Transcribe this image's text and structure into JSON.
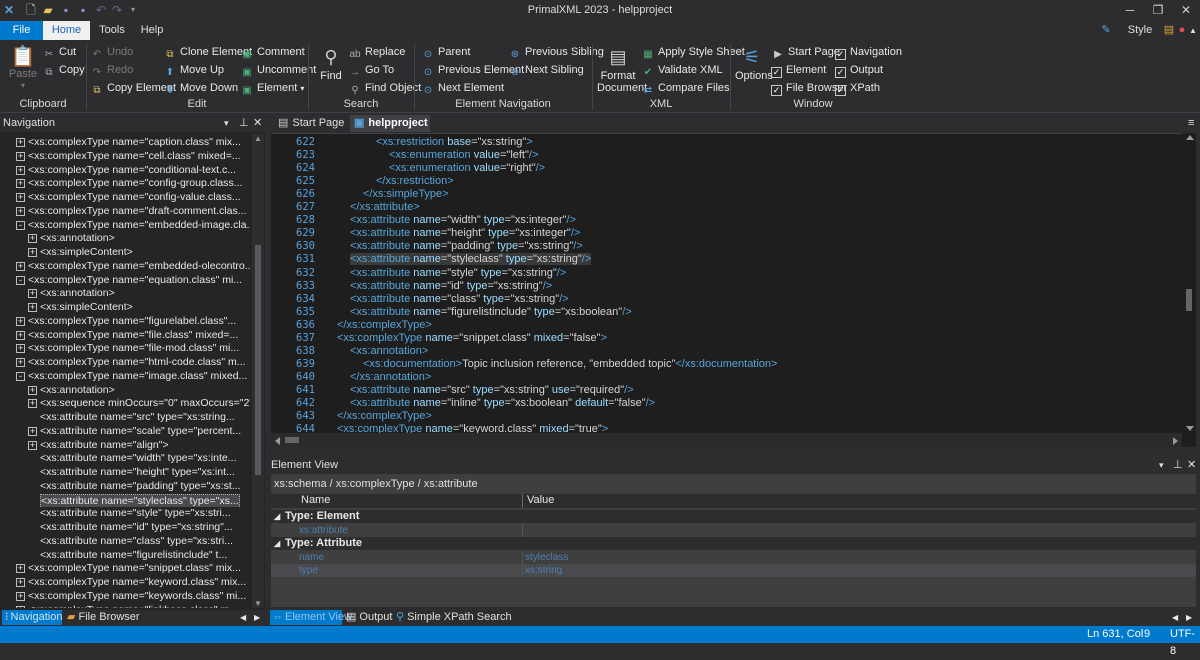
{
  "window": {
    "title": "PrimalXML 2023 - helpproject"
  },
  "ribbon_tabs": [
    "File",
    "Home",
    "Tools",
    "Help"
  ],
  "style_menu": "Style",
  "clipboard": {
    "paste": "Paste",
    "cut": "Cut",
    "copy": "Copy",
    "group": "Clipboard"
  },
  "edit": {
    "undo": "Undo",
    "redo": "Redo",
    "copy_element": "Copy Element",
    "clone_element": "Clone Element",
    "move_up": "Move Up",
    "move_down": "Move Down",
    "comment": "Comment",
    "uncomment": "Uncomment",
    "element": "Element",
    "group": "Edit"
  },
  "search": {
    "find": "Find",
    "replace": "Replace",
    "goto": "Go To",
    "find_object": "Find Object",
    "group": "Search"
  },
  "element_nav": {
    "parent": "Parent",
    "previous_element": "Previous Element",
    "next_element": "Next Element",
    "previous_sibling": "Previous Sibling",
    "next_sibling": "Next Sibling",
    "group": "Element Navigation"
  },
  "xml": {
    "format_document_1": "Format",
    "format_document_2": "Document",
    "apply_style_sheet": "Apply Style Sheet",
    "validate_xml": "Validate XML",
    "compare_files": "Compare Files",
    "group": "XML"
  },
  "window_group": {
    "options": "Options",
    "start_page": "Start Page",
    "element": "Element",
    "file_browser": "File Browser",
    "navigation": "Navigation",
    "output": "Output",
    "xpath": "XPath",
    "group": "Window"
  },
  "navigation": {
    "title": "Navigation",
    "rows": [
      {
        "depth": 1,
        "exp": "+",
        "text": "<xs:complexType name=\"caption.class\" mix..."
      },
      {
        "depth": 1,
        "exp": "+",
        "text": "<xs:complexType name=\"cell.class\" mixed=..."
      },
      {
        "depth": 1,
        "exp": "+",
        "text": "<xs:complexType name=\"conditional-text.c..."
      },
      {
        "depth": 1,
        "exp": "+",
        "text": "<xs:complexType name=\"config-group.class..."
      },
      {
        "depth": 1,
        "exp": "+",
        "text": "<xs:complexType name=\"config-value.class..."
      },
      {
        "depth": 1,
        "exp": "+",
        "text": "<xs:complexType name=\"draft-comment.clas..."
      },
      {
        "depth": 1,
        "exp": "-",
        "text": "<xs:complexType name=\"embedded-image.cla..."
      },
      {
        "depth": 2,
        "exp": "+",
        "text": "<xs:annotation>"
      },
      {
        "depth": 2,
        "exp": "+",
        "text": "<xs:simpleContent>"
      },
      {
        "depth": 1,
        "exp": "+",
        "text": "<xs:complexType name=\"embedded-olecontro..."
      },
      {
        "depth": 1,
        "exp": "-",
        "text": "<xs:complexType name=\"equation.class\" mi..."
      },
      {
        "depth": 2,
        "exp": "+",
        "text": "<xs:annotation>"
      },
      {
        "depth": 2,
        "exp": "+",
        "text": "<xs:simpleContent>"
      },
      {
        "depth": 1,
        "exp": "+",
        "text": "<xs:complexType name=\"figurelabel.class\"..."
      },
      {
        "depth": 1,
        "exp": "+",
        "text": "<xs:complexType name=\"file.class\" mixed=..."
      },
      {
        "depth": 1,
        "exp": "+",
        "text": "<xs:complexType name=\"file-mod.class\" mi..."
      },
      {
        "depth": 1,
        "exp": "+",
        "text": "<xs:complexType name=\"html-code.class\" m..."
      },
      {
        "depth": 1,
        "exp": "-",
        "text": "<xs:complexType name=\"image.class\" mixed..."
      },
      {
        "depth": 2,
        "exp": "+",
        "text": "<xs:annotation>"
      },
      {
        "depth": 2,
        "exp": "+",
        "text": "<xs:sequence minOccurs=\"0\" maxOccurs=\"2\"..."
      },
      {
        "depth": 2,
        "exp": "",
        "text": "<xs:attribute name=\"src\" type=\"xs:string..."
      },
      {
        "depth": 2,
        "exp": "+",
        "text": "<xs:attribute name=\"scale\" type=\"percent..."
      },
      {
        "depth": 2,
        "exp": "+",
        "text": "<xs:attribute name=\"align\">"
      },
      {
        "depth": 2,
        "exp": "",
        "text": "<xs:attribute name=\"width\" type=\"xs:inte..."
      },
      {
        "depth": 2,
        "exp": "",
        "text": "<xs:attribute name=\"height\" type=\"xs:int..."
      },
      {
        "depth": 2,
        "exp": "",
        "text": "<xs:attribute name=\"padding\" type=\"xs:st..."
      },
      {
        "depth": 2,
        "exp": "",
        "text": "<xs:attribute name=\"styleclass\" type=\"xs...",
        "selected": true
      },
      {
        "depth": 2,
        "exp": "",
        "text": "<xs:attribute name=\"style\" type=\"xs:stri..."
      },
      {
        "depth": 2,
        "exp": "",
        "text": "<xs:attribute name=\"id\" type=\"xs:string\"..."
      },
      {
        "depth": 2,
        "exp": "",
        "text": "<xs:attribute name=\"class\" type=\"xs:stri..."
      },
      {
        "depth": 2,
        "exp": "",
        "text": "<xs:attribute name=\"figurelistinclude\" t..."
      },
      {
        "depth": 1,
        "exp": "+",
        "text": "<xs:complexType name=\"snippet.class\" mix..."
      },
      {
        "depth": 1,
        "exp": "+",
        "text": "<xs:complexType name=\"keyword.class\" mix..."
      },
      {
        "depth": 1,
        "exp": "+",
        "text": "<xs:complexType name=\"keywords.class\" mi..."
      },
      {
        "depth": 1,
        "exp": "+",
        "text": "<xs:complexType name=\"linkbase.class\" m..."
      }
    ]
  },
  "editor_tabs": [
    {
      "label": "Start Page"
    },
    {
      "label": "helpproject"
    }
  ],
  "editor": {
    "lines": [
      {
        "n": "622",
        "indent": 3,
        "parts": [
          [
            "t",
            "<xs:restriction "
          ],
          [
            "a",
            "base"
          ],
          [
            "v",
            "="
          ],
          [
            "v",
            "\"xs:string\""
          ],
          [
            "t",
            ">"
          ]
        ]
      },
      {
        "n": "623",
        "indent": 4,
        "parts": [
          [
            "t",
            "<xs:enumeration "
          ],
          [
            "a",
            "value"
          ],
          [
            "v",
            "=\"left\""
          ],
          [
            "t",
            "/>"
          ]
        ]
      },
      {
        "n": "624",
        "indent": 4,
        "parts": [
          [
            "t",
            "<xs:enumeration "
          ],
          [
            "a",
            "value"
          ],
          [
            "v",
            "=\"right\""
          ],
          [
            "t",
            "/>"
          ]
        ]
      },
      {
        "n": "625",
        "indent": 3,
        "parts": [
          [
            "t",
            "</xs:restriction>"
          ]
        ]
      },
      {
        "n": "626",
        "indent": 2,
        "parts": [
          [
            "t",
            "</xs:simpleType>"
          ]
        ]
      },
      {
        "n": "627",
        "indent": 1,
        "parts": [
          [
            "t",
            "</xs:attribute>"
          ]
        ]
      },
      {
        "n": "628",
        "indent": 1,
        "parts": [
          [
            "t",
            "<xs:attribute "
          ],
          [
            "a",
            "name"
          ],
          [
            "v",
            "=\"width\" "
          ],
          [
            "a",
            "type"
          ],
          [
            "v",
            "=\"xs:integer\""
          ],
          [
            "t",
            "/>"
          ]
        ]
      },
      {
        "n": "629",
        "indent": 1,
        "parts": [
          [
            "t",
            "<xs:attribute "
          ],
          [
            "a",
            "name"
          ],
          [
            "v",
            "=\"height\" "
          ],
          [
            "a",
            "type"
          ],
          [
            "v",
            "=\"xs:integer\""
          ],
          [
            "t",
            "/>"
          ]
        ]
      },
      {
        "n": "630",
        "indent": 1,
        "parts": [
          [
            "t",
            "<xs:attribute "
          ],
          [
            "a",
            "name"
          ],
          [
            "v",
            "=\"padding\" "
          ],
          [
            "a",
            "type"
          ],
          [
            "v",
            "=\"xs:string\""
          ],
          [
            "t",
            "/>"
          ]
        ]
      },
      {
        "n": "631",
        "indent": 1,
        "hl": true,
        "parts": [
          [
            "t",
            "<xs:attribute "
          ],
          [
            "a",
            "name"
          ],
          [
            "v",
            "=\"styleclass\" "
          ],
          [
            "a",
            "type"
          ],
          [
            "v",
            "=\"xs:string\""
          ],
          [
            "t",
            "/>"
          ]
        ]
      },
      {
        "n": "632",
        "indent": 1,
        "parts": [
          [
            "t",
            "<xs:attribute "
          ],
          [
            "a",
            "name"
          ],
          [
            "v",
            "=\"style\" "
          ],
          [
            "a",
            "type"
          ],
          [
            "v",
            "=\"xs:string\""
          ],
          [
            "t",
            "/>"
          ]
        ]
      },
      {
        "n": "633",
        "indent": 1,
        "parts": [
          [
            "t",
            "<xs:attribute "
          ],
          [
            "a",
            "name"
          ],
          [
            "v",
            "=\"id\" "
          ],
          [
            "a",
            "type"
          ],
          [
            "v",
            "=\"xs:string\""
          ],
          [
            "t",
            "/>"
          ]
        ]
      },
      {
        "n": "634",
        "indent": 1,
        "parts": [
          [
            "t",
            "<xs:attribute "
          ],
          [
            "a",
            "name"
          ],
          [
            "v",
            "=\"class\" "
          ],
          [
            "a",
            "type"
          ],
          [
            "v",
            "=\"xs:string\""
          ],
          [
            "t",
            "/>"
          ]
        ]
      },
      {
        "n": "635",
        "indent": 1,
        "parts": [
          [
            "t",
            "<xs:attribute "
          ],
          [
            "a",
            "name"
          ],
          [
            "v",
            "=\"figurelistinclude\" "
          ],
          [
            "a",
            "type"
          ],
          [
            "v",
            "=\"xs:boolean\""
          ],
          [
            "t",
            "/>"
          ]
        ]
      },
      {
        "n": "636",
        "indent": 0,
        "parts": [
          [
            "t",
            "</xs:complexType>"
          ]
        ]
      },
      {
        "n": "637",
        "indent": 0,
        "parts": [
          [
            "t",
            "<xs:complexType "
          ],
          [
            "a",
            "name"
          ],
          [
            "v",
            "=\"snippet.class\" "
          ],
          [
            "a",
            "mixed"
          ],
          [
            "v",
            "=\"false\""
          ],
          [
            "t",
            ">"
          ]
        ]
      },
      {
        "n": "638",
        "indent": 1,
        "parts": [
          [
            "t",
            "<xs:annotation>"
          ]
        ]
      },
      {
        "n": "639",
        "indent": 2,
        "parts": [
          [
            "t",
            "<xs:documentation>"
          ],
          [
            "v",
            "Topic inclusion reference, \"embedded topic\""
          ],
          [
            "t",
            "</xs:documentation>"
          ]
        ]
      },
      {
        "n": "640",
        "indent": 1,
        "parts": [
          [
            "t",
            "</xs:annotation>"
          ]
        ]
      },
      {
        "n": "641",
        "indent": 1,
        "parts": [
          [
            "t",
            "<xs:attribute "
          ],
          [
            "a",
            "name"
          ],
          [
            "v",
            "=\"src\" "
          ],
          [
            "a",
            "type"
          ],
          [
            "v",
            "=\"xs:string\" "
          ],
          [
            "a",
            "use"
          ],
          [
            "v",
            "=\"required\""
          ],
          [
            "t",
            "/>"
          ]
        ]
      },
      {
        "n": "642",
        "indent": 1,
        "parts": [
          [
            "t",
            "<xs:attribute "
          ],
          [
            "a",
            "name"
          ],
          [
            "v",
            "=\"inline\" "
          ],
          [
            "a",
            "type"
          ],
          [
            "v",
            "=\"xs:boolean\" "
          ],
          [
            "a",
            "default"
          ],
          [
            "v",
            "=\"false\""
          ],
          [
            "t",
            "/>"
          ]
        ]
      },
      {
        "n": "643",
        "indent": 0,
        "parts": [
          [
            "t",
            "</xs:complexType>"
          ]
        ]
      },
      {
        "n": "644",
        "indent": 0,
        "parts": [
          [
            "t",
            "<xs:complexType "
          ],
          [
            "a",
            "name"
          ],
          [
            "v",
            "=\"keyword.class\" "
          ],
          [
            "a",
            "mixed"
          ],
          [
            "v",
            "=\"true\""
          ],
          [
            "t",
            ">"
          ]
        ]
      }
    ]
  },
  "element_view": {
    "title": "Element View",
    "path": "xs:schema / xs:complexType / xs:attribute",
    "col_name": "Name",
    "col_value": "Value",
    "group1": "Type:  Element",
    "element_name": "xs:attribute",
    "group2": "Type: Attribute",
    "attrs": [
      {
        "name": "name",
        "value": "styleclass"
      },
      {
        "name": "type",
        "value": "xs:string"
      }
    ]
  },
  "bottom_tabs_left": [
    "Navigation",
    "File Browser"
  ],
  "bottom_tabs_right": [
    "Element View",
    "Output",
    "Simple XPath Search"
  ],
  "status": {
    "ln": "Ln  631, Col",
    "col": "9",
    "encoding": "UTF-8"
  },
  "colors": {
    "accent": "#007acc",
    "tag": "#57a6dc",
    "attr": "#9cdcfe",
    "background": "#2d2d30"
  }
}
